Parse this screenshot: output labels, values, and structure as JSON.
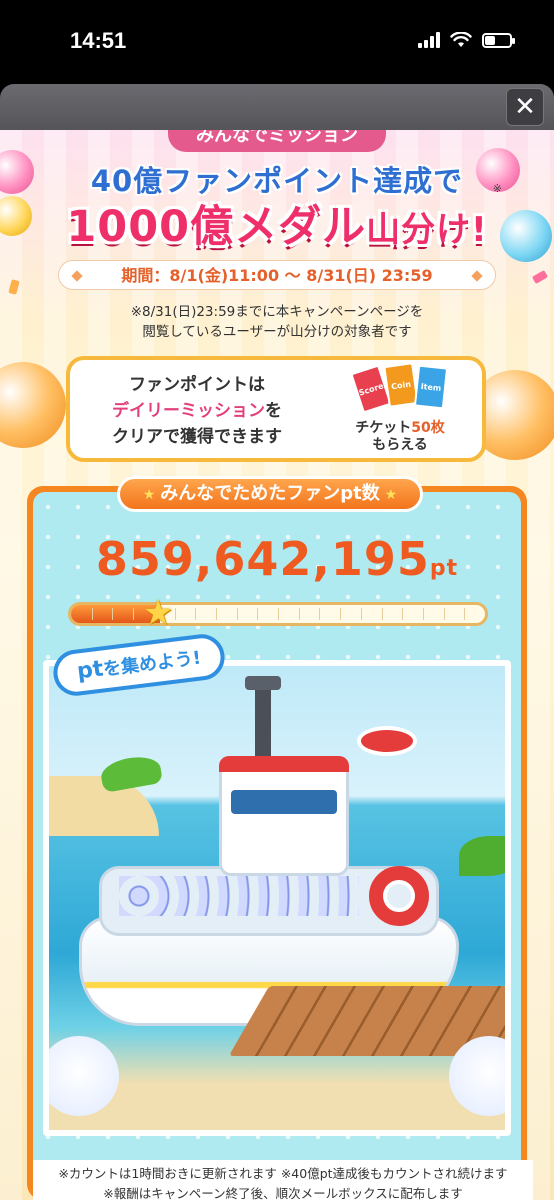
{
  "status_bar": {
    "time": "14:51",
    "battery_level": 0.42
  },
  "modal": {
    "close_icon": "close-icon"
  },
  "banner": {
    "tab_label": "みんなでミッション",
    "title_line1": "40億ファンポイント達成で",
    "title_line2_big": "1000億メダル",
    "title_line2_small": "山分け!",
    "note_mark": "※",
    "period": "期間：8/1(金)11:00 ～ 8/31(日) 23:59",
    "notice_line1": "※8/31(日)23:59までに本キャンペーンページを",
    "notice_line2": "閲覧しているユーザーが山分けの対象者です"
  },
  "info": {
    "line1": "ファンポイントは",
    "line2_highlight": "デイリーミッション",
    "line2_rest": "を",
    "line3": "クリアで獲得できます",
    "ticket_label_pre": "チケット",
    "ticket_label_count": "50枚",
    "ticket_label_post": "もらえる",
    "ticket_texts": [
      "Score",
      "Coin",
      "Item"
    ]
  },
  "counter": {
    "ribbon_label": "みんなでためたファンpt数",
    "value": "859,642,195",
    "unit": "pt",
    "progress_fraction": 0.215,
    "colors": {
      "accent": "#ee5a1f",
      "panel": "#f4871f"
    }
  },
  "scene": {
    "tag_pt": "pt",
    "tag_rest": "を集めよう!"
  },
  "footnote": {
    "line1": "※カウントは1時間おきに更新されます ※40億pt達成後もカウントされ続けます",
    "line2": "※報酬はキャンペーン終了後、順次メールボックスに配布します"
  }
}
